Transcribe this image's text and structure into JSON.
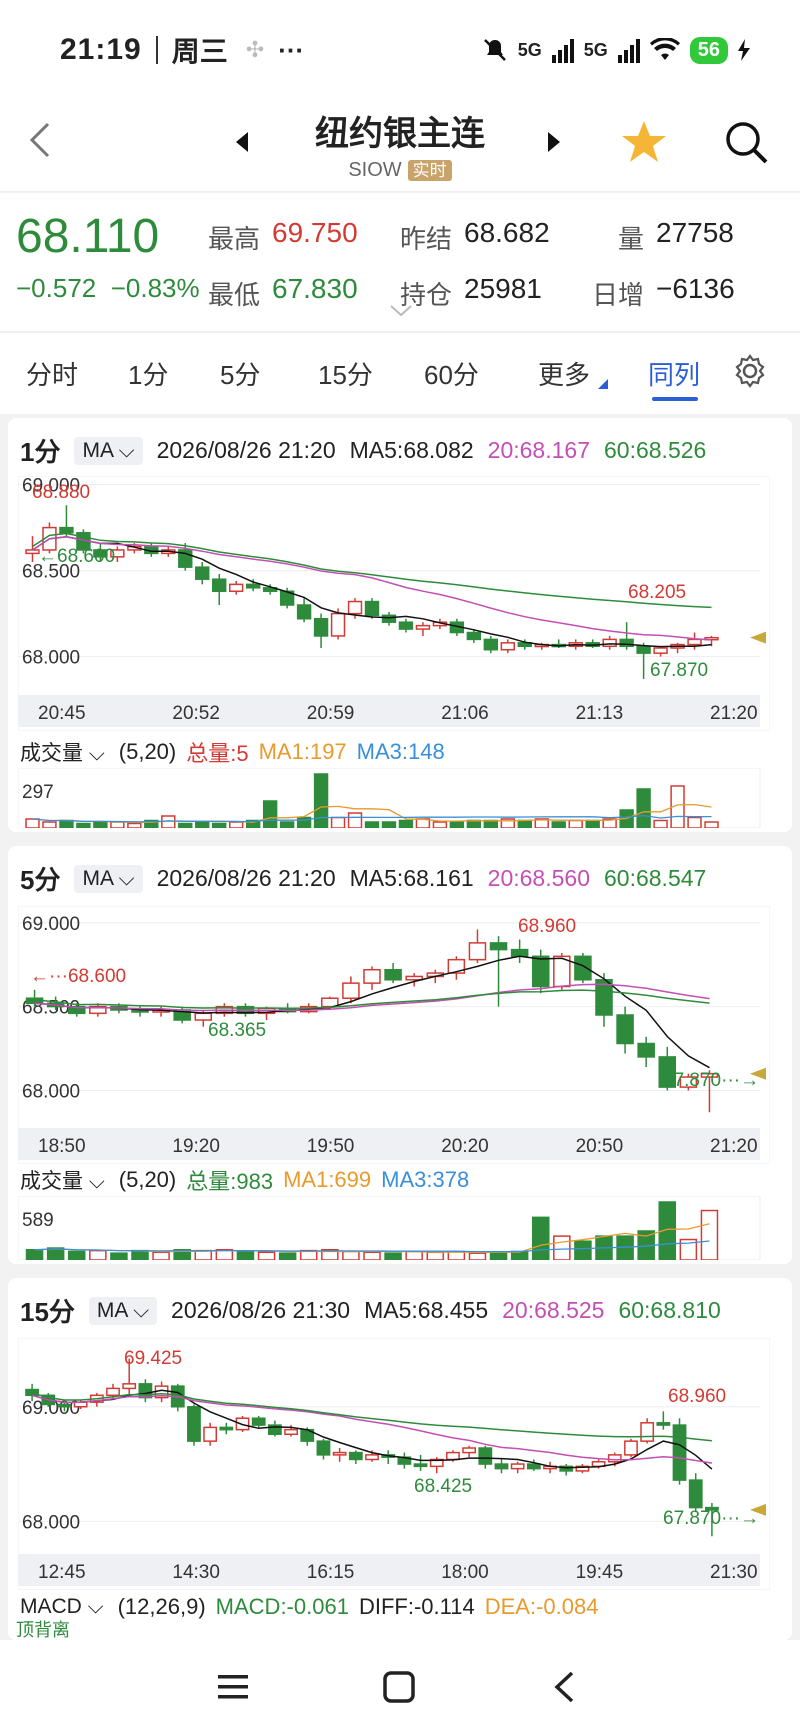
{
  "status_bar": {
    "time": "21:19",
    "weekday": "周三",
    "mid_icon": "✣",
    "dots": "···",
    "net1": "5G",
    "net2": "5G",
    "battery": "56"
  },
  "nav": {
    "title": "纽约银主连",
    "code": "SIOW",
    "code_badge": "实时"
  },
  "quote": {
    "price": "68.110",
    "change": "−0.572",
    "change_pct": "−0.83%",
    "high_label": "最高",
    "high": "69.750",
    "low_label": "最低",
    "low": "67.830",
    "prev_settle_label": "昨结",
    "prev_settle": "68.682",
    "open_interest_label": "持仓",
    "open_interest": "25981",
    "volume_label": "量",
    "volume": "27758",
    "daily_change_label": "日增",
    "daily_change": "−6136"
  },
  "tabs": [
    "分时",
    "1分",
    "5分",
    "15分",
    "60分",
    "更多",
    "同列"
  ],
  "active_tab": "同列",
  "colors": {
    "up": "#d23b33",
    "down": "#2e8b3c",
    "ma5": "#111111",
    "ma20": "#c44fb4",
    "ma60": "#2e8b3c",
    "ma1": "#e89a2c",
    "ma3": "#3a8fd9",
    "accent": "#2a5fd6"
  },
  "panels": [
    {
      "period": "1分",
      "indicator": "MA",
      "datetime": "2026/08/26 21:20",
      "ma5": "MA5:68.082",
      "ma20": "20:68.167",
      "ma60": "60:68.526",
      "y_labels": [
        "69.000",
        "68.500",
        "68.000"
      ],
      "x_labels": [
        "20:45",
        "20:52",
        "20:59",
        "21:06",
        "21:13",
        "21:20"
      ],
      "annotations": {
        "max": "68.880",
        "ref": "68.600",
        "hi": "68.205",
        "lo": "67.870"
      },
      "vol": {
        "label": "成交量",
        "params": "(5,20)",
        "total": "总量:5",
        "ma1": "MA1:197",
        "ma3": "MA3:148",
        "y": "297"
      },
      "chart_data": {
        "type": "candlestick",
        "y_range": [
          67.8,
          69.05
        ],
        "ohlc": [
          [
            68.6,
            68.7,
            68.55,
            68.62
          ],
          [
            68.62,
            68.78,
            68.6,
            68.75
          ],
          [
            68.75,
            68.88,
            68.7,
            68.72
          ],
          [
            68.72,
            68.74,
            68.6,
            68.62
          ],
          [
            68.62,
            68.66,
            68.55,
            68.58
          ],
          [
            68.58,
            68.64,
            68.55,
            68.62
          ],
          [
            68.62,
            68.66,
            68.6,
            68.64
          ],
          [
            68.64,
            68.66,
            68.58,
            68.6
          ],
          [
            68.6,
            68.64,
            68.58,
            68.62
          ],
          [
            68.62,
            68.66,
            68.5,
            68.52
          ],
          [
            68.52,
            68.55,
            68.42,
            68.45
          ],
          [
            68.45,
            68.48,
            68.3,
            68.38
          ],
          [
            68.38,
            68.44,
            68.36,
            68.42
          ],
          [
            68.42,
            68.45,
            68.38,
            68.4
          ],
          [
            68.4,
            68.42,
            68.36,
            68.38
          ],
          [
            68.38,
            68.4,
            68.28,
            68.3
          ],
          [
            68.3,
            68.34,
            68.2,
            68.22
          ],
          [
            68.22,
            68.25,
            68.05,
            68.12
          ],
          [
            68.12,
            68.28,
            68.1,
            68.25
          ],
          [
            68.25,
            68.34,
            68.22,
            68.32
          ],
          [
            68.32,
            68.34,
            68.22,
            68.24
          ],
          [
            68.24,
            68.26,
            68.18,
            68.2
          ],
          [
            68.2,
            68.22,
            68.14,
            68.16
          ],
          [
            68.16,
            68.2,
            68.12,
            68.18
          ],
          [
            68.18,
            68.22,
            68.16,
            68.2
          ],
          [
            68.2,
            68.22,
            68.12,
            68.14
          ],
          [
            68.14,
            68.16,
            68.08,
            68.1
          ],
          [
            68.1,
            68.12,
            68.02,
            68.04
          ],
          [
            68.04,
            68.1,
            68.02,
            68.08
          ],
          [
            68.08,
            68.1,
            68.04,
            68.06
          ],
          [
            68.06,
            68.08,
            68.04,
            68.07
          ],
          [
            68.07,
            68.1,
            68.05,
            68.06
          ],
          [
            68.06,
            68.1,
            68.04,
            68.08
          ],
          [
            68.08,
            68.1,
            68.05,
            68.06
          ],
          [
            68.06,
            68.12,
            68.04,
            68.1
          ],
          [
            68.1,
            68.2,
            68.04,
            68.06
          ],
          [
            68.06,
            68.08,
            67.87,
            68.02
          ],
          [
            68.02,
            68.06,
            68.0,
            68.05
          ],
          [
            68.05,
            68.08,
            68.02,
            68.07
          ],
          [
            68.07,
            68.14,
            68.04,
            68.1
          ],
          [
            68.1,
            68.12,
            68.06,
            68.11
          ]
        ],
        "volume": [
          30,
          20,
          25,
          15,
          20,
          20,
          15,
          25,
          40,
          15,
          20,
          15,
          20,
          25,
          90,
          20,
          35,
          180,
          35,
          50,
          20,
          20,
          25,
          30,
          20,
          20,
          25,
          25,
          30,
          25,
          30,
          20,
          25,
          25,
          30,
          60,
          130,
          25,
          140,
          35,
          20
        ]
      }
    },
    {
      "period": "5分",
      "indicator": "MA",
      "datetime": "2026/08/26 21:20",
      "ma5": "MA5:68.161",
      "ma20": "20:68.560",
      "ma60": "60:68.547",
      "y_labels": [
        "69.000",
        "68.500",
        "68.000"
      ],
      "x_labels": [
        "18:50",
        "19:20",
        "19:50",
        "20:20",
        "20:50",
        "21:20"
      ],
      "annotations": {
        "max": "68.960",
        "ref": "68.600",
        "lo_mid": "68.365",
        "lo": "67.870"
      },
      "vol": {
        "label": "成交量",
        "params": "(5,20)",
        "total": "总量:983",
        "ma1": "MA1:699",
        "ma3": "MA3:378",
        "y": "589"
      },
      "chart_data": {
        "type": "candlestick",
        "y_range": [
          67.8,
          69.1
        ],
        "ohlc": [
          [
            68.55,
            68.6,
            68.5,
            68.52
          ],
          [
            68.52,
            68.56,
            68.48,
            68.5
          ],
          [
            68.5,
            68.52,
            68.44,
            68.46
          ],
          [
            68.46,
            68.52,
            68.44,
            68.5
          ],
          [
            68.5,
            68.52,
            68.46,
            68.48
          ],
          [
            68.48,
            68.5,
            68.44,
            68.47
          ],
          [
            68.47,
            68.5,
            68.44,
            68.48
          ],
          [
            68.48,
            68.5,
            68.4,
            68.42
          ],
          [
            68.42,
            68.48,
            68.38,
            68.46
          ],
          [
            68.46,
            68.52,
            68.44,
            68.5
          ],
          [
            68.5,
            68.52,
            68.44,
            68.46
          ],
          [
            68.46,
            68.5,
            68.42,
            68.49
          ],
          [
            68.49,
            68.52,
            68.46,
            68.47
          ],
          [
            68.47,
            68.52,
            68.46,
            68.5
          ],
          [
            68.5,
            68.56,
            68.48,
            68.55
          ],
          [
            68.55,
            68.68,
            68.52,
            68.64
          ],
          [
            68.64,
            68.74,
            68.6,
            68.72
          ],
          [
            68.72,
            68.76,
            68.64,
            68.66
          ],
          [
            68.66,
            68.7,
            68.62,
            68.68
          ],
          [
            68.68,
            68.72,
            68.64,
            68.7
          ],
          [
            68.7,
            68.8,
            68.66,
            68.78
          ],
          [
            68.78,
            68.96,
            68.76,
            68.88
          ],
          [
            68.88,
            68.92,
            68.5,
            68.84
          ],
          [
            68.84,
            68.9,
            68.76,
            68.8
          ],
          [
            68.8,
            68.84,
            68.58,
            68.62
          ],
          [
            68.62,
            68.82,
            68.6,
            68.8
          ],
          [
            68.8,
            68.82,
            68.64,
            68.66
          ],
          [
            68.66,
            68.7,
            68.38,
            68.45
          ],
          [
            68.45,
            68.5,
            68.22,
            68.28
          ],
          [
            68.28,
            68.32,
            68.14,
            68.2
          ],
          [
            68.2,
            68.26,
            68.0,
            68.02
          ],
          [
            68.02,
            68.1,
            68.0,
            68.08
          ],
          [
            68.08,
            68.12,
            67.87,
            68.1
          ]
        ],
        "volume": [
          60,
          70,
          50,
          55,
          40,
          55,
          45,
          60,
          55,
          60,
          50,
          45,
          40,
          55,
          60,
          50,
          45,
          40,
          50,
          45,
          50,
          40,
          45,
          50,
          250,
          140,
          110,
          140,
          140,
          170,
          340,
          120,
          290
        ]
      }
    },
    {
      "period": "15分",
      "indicator": "MA",
      "datetime": "2026/08/26 21:30",
      "ma5": "MA5:68.455",
      "ma20": "20:68.525",
      "ma60": "60:68.810",
      "y_labels": [
        "69.000",
        "68.000"
      ],
      "x_labels": [
        "12:45",
        "14:30",
        "16:15",
        "18:00",
        "19:45",
        "21:30"
      ],
      "annotations": {
        "max": "69.425",
        "lo_mid": "68.425",
        "hi": "68.960",
        "lo": "67.870"
      },
      "macd": {
        "label": "MACD",
        "params": "(12,26,9)",
        "macd": "MACD:-0.061",
        "diff": "DIFF:-0.114",
        "dea": "DEA:-0.084",
        "tag": "顶背离"
      },
      "chart_data": {
        "type": "candlestick",
        "y_range": [
          67.75,
          69.6
        ],
        "ohlc": [
          [
            69.15,
            69.2,
            69.05,
            69.1
          ],
          [
            69.1,
            69.12,
            69.0,
            69.02
          ],
          [
            69.02,
            69.06,
            68.96,
            69.0
          ],
          [
            69.0,
            69.06,
            68.98,
            69.04
          ],
          [
            69.04,
            69.12,
            69.0,
            69.1
          ],
          [
            69.1,
            69.2,
            69.06,
            69.16
          ],
          [
            69.16,
            69.42,
            69.1,
            69.2
          ],
          [
            69.2,
            69.24,
            69.04,
            69.08
          ],
          [
            69.08,
            69.22,
            69.04,
            69.18
          ],
          [
            69.18,
            69.2,
            68.96,
            69.0
          ],
          [
            69.0,
            69.02,
            68.66,
            68.7
          ],
          [
            68.7,
            68.86,
            68.66,
            68.82
          ],
          [
            68.82,
            68.86,
            68.76,
            68.8
          ],
          [
            68.8,
            68.92,
            68.78,
            68.9
          ],
          [
            68.9,
            68.92,
            68.82,
            68.84
          ],
          [
            68.84,
            68.88,
            68.74,
            68.76
          ],
          [
            68.76,
            68.84,
            68.74,
            68.8
          ],
          [
            68.8,
            68.82,
            68.66,
            68.7
          ],
          [
            68.7,
            68.72,
            68.54,
            68.58
          ],
          [
            68.58,
            68.64,
            68.52,
            68.6
          ],
          [
            68.6,
            68.62,
            68.5,
            68.54
          ],
          [
            68.54,
            68.62,
            68.52,
            68.58
          ],
          [
            68.58,
            68.62,
            68.5,
            68.56
          ],
          [
            68.56,
            68.6,
            68.46,
            68.5
          ],
          [
            68.5,
            68.58,
            68.44,
            68.48
          ],
          [
            68.48,
            68.56,
            68.42,
            68.54
          ],
          [
            68.54,
            68.62,
            68.52,
            68.6
          ],
          [
            68.6,
            68.66,
            68.56,
            68.64
          ],
          [
            68.64,
            68.66,
            68.46,
            68.5
          ],
          [
            68.5,
            68.54,
            68.42,
            68.46
          ],
          [
            68.46,
            68.52,
            68.42,
            68.5
          ],
          [
            68.5,
            68.54,
            68.44,
            68.46
          ],
          [
            68.46,
            68.52,
            68.42,
            68.48
          ],
          [
            68.48,
            68.5,
            68.4,
            68.44
          ],
          [
            68.44,
            68.5,
            68.42,
            68.48
          ],
          [
            68.48,
            68.54,
            68.46,
            68.52
          ],
          [
            68.52,
            68.6,
            68.48,
            68.58
          ],
          [
            68.58,
            68.72,
            68.56,
            68.7
          ],
          [
            68.7,
            68.9,
            68.68,
            68.86
          ],
          [
            68.86,
            68.96,
            68.8,
            68.84
          ],
          [
            68.84,
            68.9,
            68.32,
            68.36
          ],
          [
            68.36,
            68.42,
            68.08,
            68.12
          ],
          [
            68.12,
            68.16,
            67.87,
            68.1
          ]
        ]
      }
    }
  ],
  "bottom_nav": {
    "menu_icon": "menu-icon",
    "home_icon": "home-icon",
    "back_icon": "back-icon"
  }
}
